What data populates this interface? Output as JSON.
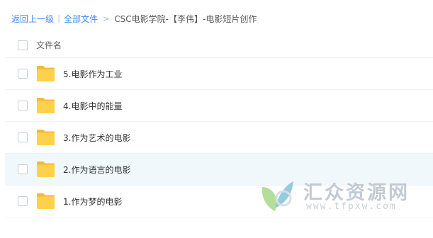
{
  "breadcrumb": {
    "back_label": "返回上一级",
    "separator": "|",
    "all_files_label": "全部文件",
    "arrow": ">",
    "current_folder": "CSC电影学院-【李伟】-电影短片创作"
  },
  "list_header": {
    "column_label": "文件名"
  },
  "items": [
    {
      "label": "5.电影作为工业",
      "icon": "folder-icon"
    },
    {
      "label": "4.电影中的能量",
      "icon": "folder-icon"
    },
    {
      "label": "3.作为艺术的电影",
      "icon": "folder-icon"
    },
    {
      "label": "2.作为语言的电影",
      "icon": "folder-icon"
    },
    {
      "label": "1.作为梦的电影",
      "icon": "folder-icon"
    }
  ],
  "watermark": {
    "title": "汇众资源网",
    "url": "www.tfpxw.com"
  },
  "colors": {
    "link": "#3b8cff",
    "folder": "#ffd04b",
    "folder_tab": "#f5b83d",
    "hover_row": "#f0f8fc"
  }
}
